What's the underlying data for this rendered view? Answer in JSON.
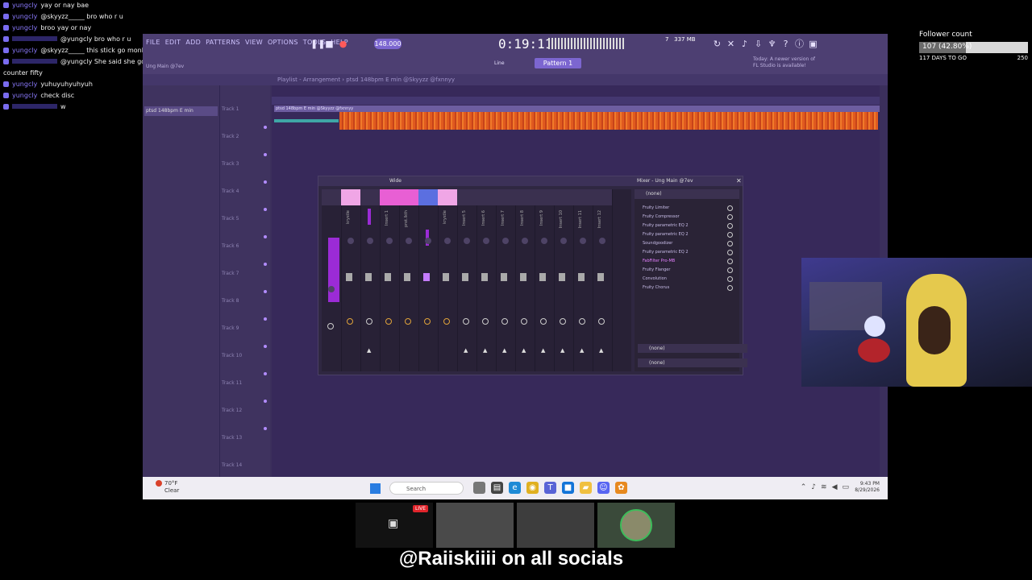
{
  "chat": {
    "messages": [
      {
        "user": "yungcly",
        "text": "yay or nay bae"
      },
      {
        "user": "yungcly",
        "text": "@skyyzz_____ bro who r u"
      },
      {
        "user": "yungcly",
        "text": "broo yay or nay"
      },
      {
        "user": "",
        "text": "@yungcly bro who r u"
      },
      {
        "user": "yungcly",
        "text": "@skyyzz_____ this stick go monkey nuts i go bananas w it"
      },
      {
        "user": "",
        "text": "@yungcly She said she goin' for nothin', I gave her"
      },
      {
        "user": "",
        "text": "counter fifty"
      },
      {
        "user": "yungcly",
        "text": "yuhuyuhyuhyuh"
      },
      {
        "user": "yungcly",
        "text": "check disc"
      },
      {
        "user": "",
        "text": "w"
      }
    ]
  },
  "follower": {
    "title": "Follower count",
    "progress_text": "107 (42.80%)",
    "progress": 0.428,
    "days_label": "117 DAYS TO GO",
    "goal": "250",
    "zero": "0"
  },
  "fl": {
    "menu": [
      "FILE",
      "EDIT",
      "ADD",
      "PATTERNS",
      "VIEW",
      "OPTIONS",
      "TOOLS",
      "HELP"
    ],
    "tempo": "148.000",
    "time": "0:19:11",
    "cpu": "7   337 MB\n           0",
    "pattern": "Pattern 1",
    "news": "Today: A newer version of FL Studio is available!",
    "window_name": "Ung Main @7ev",
    "snap": "Line",
    "playlist_title": "Playlist - Arrangement › ptsd 148bpm E min @Skyyzz @fxnnyy",
    "browser_item": "ptsd 148bpm E min",
    "clip_label": "ptsd 148bpm E min @Skyyzz @fxnnyy",
    "tracks": [
      "Track 1",
      "Track 2",
      "Track 3",
      "Track 4",
      "Track 5",
      "Track 6",
      "Track 7",
      "Track 8",
      "Track 9",
      "Track 10",
      "Track 11",
      "Track 12",
      "Track 13",
      "Track 14"
    ]
  },
  "mixer": {
    "title": "Mixer - Ung Main @7ev",
    "view": "Wide",
    "preset": "(none)",
    "strip_names": [
      "",
      "krystle",
      "",
      "Insert 1",
      "prot.lkth",
      "",
      "krystle",
      "Insert 5",
      "Insert 6",
      "Insert 7",
      "Insert 8",
      "Insert 9",
      "Insert 10",
      "Insert 11",
      "Insert 12"
    ],
    "effects": [
      "Fruity Limiter",
      "Fruity Compressor",
      "Fruity parametric EQ 2",
      "Fruity parametric EQ 2",
      "Soundgoodizer",
      "Fruity parametric EQ 2",
      "FabFilter Pro-MB",
      "Fruity Flanger",
      "Convolution",
      "Fruity Chorus"
    ],
    "bottom1": "(none)",
    "bottom2": "(none)"
  },
  "taskbar": {
    "temp": "70°F",
    "weather": "Clear",
    "search": "Search",
    "time": "9:43 PM",
    "date": "8/29/2026"
  },
  "tiles": {
    "live": "LIVE"
  },
  "socials": "@Raiiskiiii on all socials"
}
